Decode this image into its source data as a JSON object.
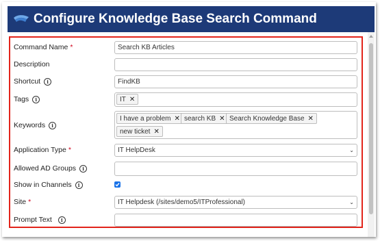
{
  "header": {
    "title": "Configure Knowledge Base Search Command"
  },
  "fields": {
    "command_name": {
      "label": "Command Name",
      "required": "*",
      "value": "Search KB Articles"
    },
    "description": {
      "label": "Description",
      "value": ""
    },
    "shortcut": {
      "label": "Shortcut",
      "value": "FindKB"
    },
    "tags": {
      "label": "Tags",
      "items": [
        "IT"
      ]
    },
    "keywords": {
      "label": "Keywords",
      "items": [
        "I have a problem",
        "search KB",
        "Search Knowledge Base",
        "new ticket"
      ]
    },
    "application_type": {
      "label": "Application Type",
      "required": "*",
      "value": "IT HelpDesk"
    },
    "allowed_ad_groups": {
      "label": "Allowed AD Groups",
      "value": ""
    },
    "show_in_channels": {
      "label": "Show in Channels",
      "checked": true
    },
    "site": {
      "label": "Site",
      "required": "*",
      "value": "IT Helpdesk (/sites/demo5/ITProfessional)"
    },
    "prompt_text": {
      "label": "Prompt Text",
      "value": ""
    }
  },
  "icons": {
    "info": "info-circle-icon",
    "remove": "close-icon",
    "dropdown": "chevron-down-icon",
    "check": "checkmark-icon"
  },
  "colors": {
    "header_bg": "#1d3a78",
    "highlight_border": "#e2231a",
    "required": "#d0021b",
    "checkbox": "#1a73e8"
  }
}
